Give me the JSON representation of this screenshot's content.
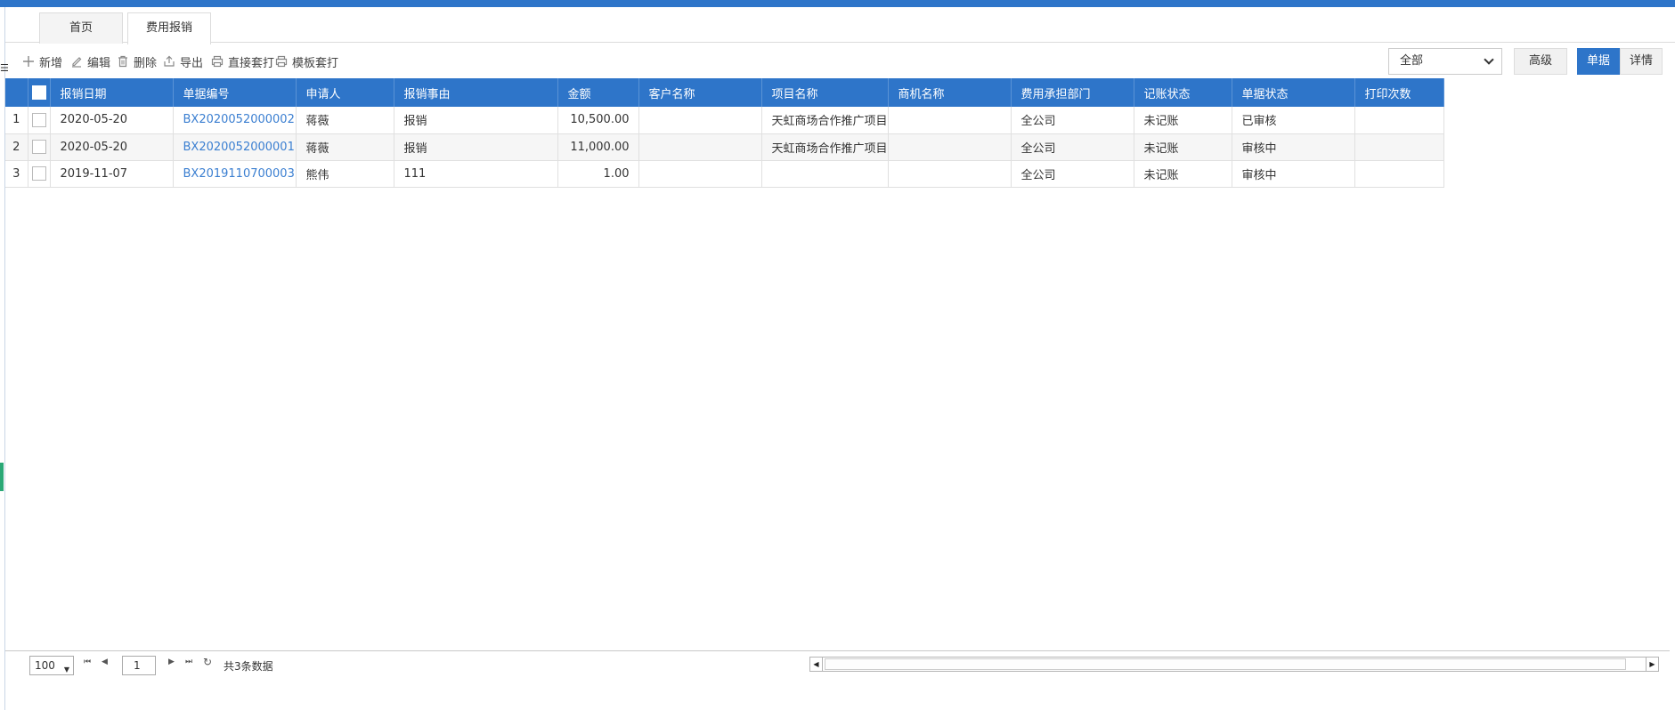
{
  "tabs": [
    {
      "label": "首页"
    },
    {
      "label": "费用报销"
    }
  ],
  "toolbar": {
    "add": "新增",
    "edit": "编辑",
    "delete": "删除",
    "export": "导出",
    "direct_print": "直接套打",
    "template_print": "模板套打",
    "filter_value": "全部",
    "advanced": "高级",
    "view_single": "单据",
    "view_detail": "详情"
  },
  "table": {
    "columns": [
      "报销日期",
      "单据编号",
      "申请人",
      "报销事由",
      "金额",
      "客户名称",
      "项目名称",
      "商机名称",
      "费用承担部门",
      "记账状态",
      "单据状态",
      "打印次数"
    ],
    "rows": [
      {
        "no": "1",
        "date": "2020-05-20",
        "code": "BX2020052000002",
        "applicant": "蒋薇",
        "reason": "报销",
        "amount": "10,500.00",
        "customer": "",
        "project": "天虹商场合作推广项目",
        "opportunity": "",
        "dept": "全公司",
        "posting": "未记账",
        "status": "已审核",
        "prints": ""
      },
      {
        "no": "2",
        "date": "2020-05-20",
        "code": "BX2020052000001",
        "applicant": "蒋薇",
        "reason": "报销",
        "amount": "11,000.00",
        "customer": "",
        "project": "天虹商场合作推广项目",
        "opportunity": "",
        "dept": "全公司",
        "posting": "未记账",
        "status": "审核中",
        "prints": ""
      },
      {
        "no": "3",
        "date": "2019-11-07",
        "code": "BX2019110700003",
        "applicant": "熊伟",
        "reason": "111",
        "amount": "1.00",
        "customer": "",
        "project": "",
        "opportunity": "",
        "dept": "全公司",
        "posting": "未记账",
        "status": "审核中",
        "prints": ""
      }
    ]
  },
  "pager": {
    "page_size": "100",
    "page": "1",
    "total": "共3条数据"
  },
  "colors": {
    "primary": "#2e75c9",
    "link": "#3b7fd1"
  }
}
